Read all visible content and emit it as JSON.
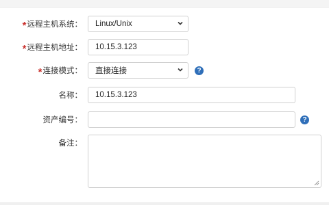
{
  "form": {
    "os": {
      "label": "远程主机系统：",
      "required": true,
      "value": "Linux/Unix"
    },
    "address": {
      "label": "远程主机地址：",
      "required": true,
      "value": "10.15.3.123"
    },
    "connect_mode": {
      "label": "连接模式：",
      "required": true,
      "value": "直接连接",
      "help_icon": "question-icon"
    },
    "name": {
      "label": "名称：",
      "value": "10.15.3.123"
    },
    "asset_no": {
      "label": "资产编号：",
      "value": "",
      "help_icon": "question-icon"
    },
    "remark": {
      "label": "备注：",
      "value": ""
    }
  },
  "colors": {
    "required_mark": "#c9302c",
    "help_icon": "#2f6fb9",
    "border": "#cfcfcf"
  },
  "required_mark": "*",
  "help_glyph": "?"
}
